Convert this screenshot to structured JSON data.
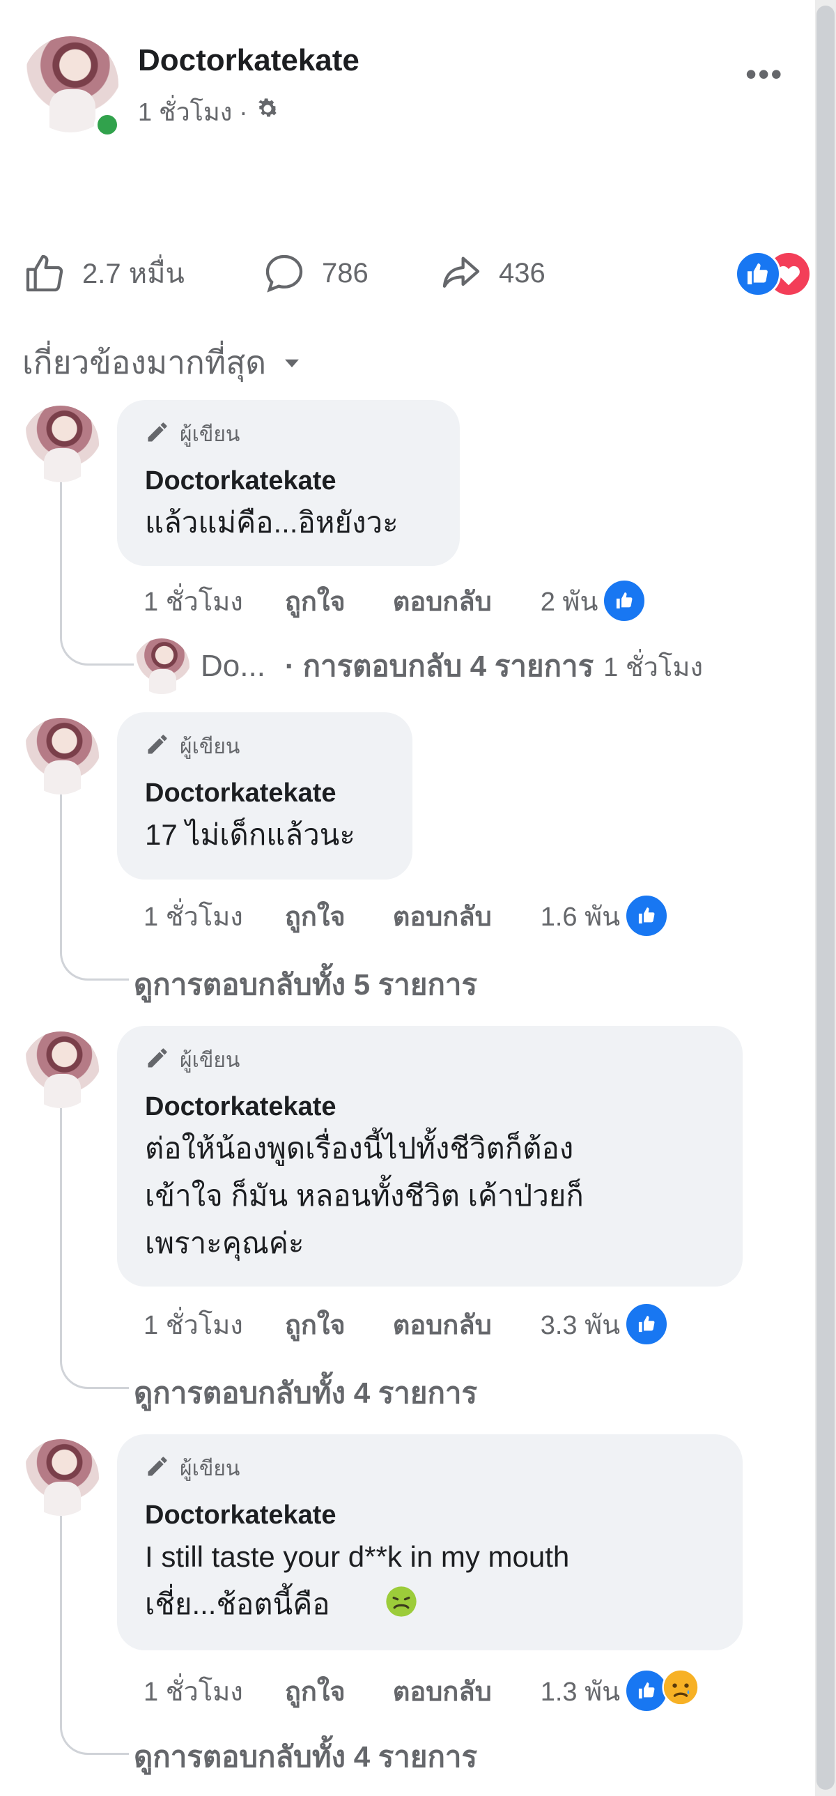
{
  "post": {
    "author": "Doctorkatekate",
    "time": "1 ชั่วโมง ·",
    "audience_icon": "gear-icon",
    "more_icon": "more-dots-icon"
  },
  "stats": {
    "likes": "2.7 หมื่น",
    "comments": "786",
    "shares": "436",
    "reaction_icons": [
      "like-reaction-icon",
      "love-reaction-icon"
    ]
  },
  "filter": {
    "label": "เกี่ยวข้องมากที่สุด"
  },
  "comments": [
    {
      "badge": "ผู้เขียน",
      "author": "Doctorkatekate",
      "text": "แล้วแม่คือ...อิหยังวะ",
      "time": "1 ชั่วโมง",
      "like": "ถูกใจ",
      "reply": "ตอบกลับ",
      "reaction_count": "2 พัน",
      "reply_preview": {
        "author": "Do...",
        "text": "· การตอบกลับ 4 รายการ",
        "time": "1 ชั่วโมง"
      }
    },
    {
      "badge": "ผู้เขียน",
      "author": "Doctorkatekate",
      "text": "17 ไม่เด็กแล้วนะ",
      "time": "1 ชั่วโมง",
      "like": "ถูกใจ",
      "reply": "ตอบกลับ",
      "reaction_count": "1.6 พัน",
      "view_replies": "ดูการตอบกลับทั้ง 5 รายการ"
    },
    {
      "badge": "ผู้เขียน",
      "author": "Doctorkatekate",
      "text": "ต่อให้น้องพูดเรื่องนี้ไปทั้งชีวิตก็ต้อง\nเข้าใจ ก็มัน หลอนทั้งชีวิต เค้าป่วยก็\nเพราะคุณค่ะ",
      "time": "1 ชั่วโมง",
      "like": "ถูกใจ",
      "reply": "ตอบกลับ",
      "reaction_count": "3.3 พัน",
      "view_replies": "ดูการตอบกลับทั้ง 4 รายการ"
    },
    {
      "badge": "ผู้เขียน",
      "author": "Doctorkatekate",
      "text": "I still taste your d**k in my mouth\nเชี่ย...ช้อตนี้คือ",
      "emoji": "nauseated-face-emoji",
      "time": "1 ชั่วโมง",
      "like": "ถูกใจ",
      "reply": "ตอบกลับ",
      "reaction_count": "1.3 พัน",
      "view_replies": "ดูการตอบกลับทั้ง 4 รายการ"
    }
  ],
  "colors": {
    "facebook_blue": "#1877f2",
    "love_red": "#f33e58",
    "bubble_bg": "#f0f2f5",
    "secondary_text": "#65676b",
    "online_green": "#31a24c"
  }
}
